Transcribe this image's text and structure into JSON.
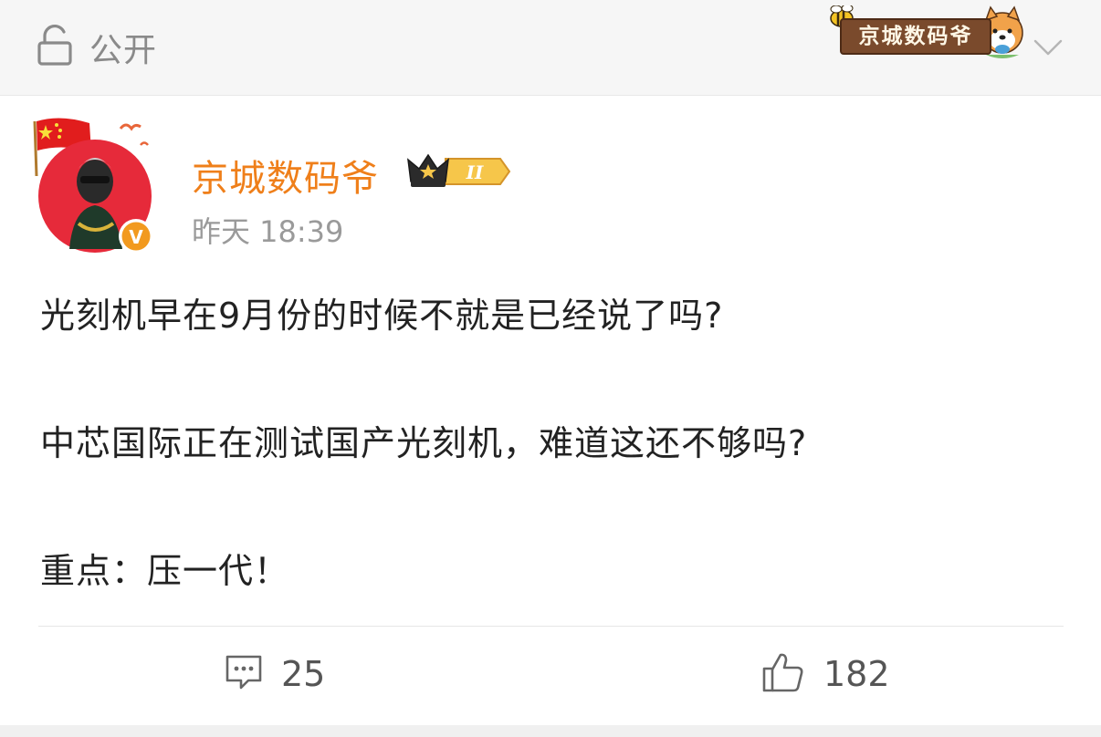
{
  "header": {
    "visibility_label": "公开",
    "watermark_text": "京城数码爷",
    "icons": [
      "lock-icon",
      "chevron-down-icon"
    ]
  },
  "post": {
    "author": {
      "name": "京城数码爷",
      "badge_text": "II",
      "verified_mark": "V",
      "name_color": "#ef7f1a"
    },
    "time": "昨天 18:39",
    "paragraphs": [
      "光刻机早在9月份的时候不就是已经说了吗?",
      "中芯国际正在测试国产光刻机，难道这还不够吗?",
      "重点：压一代！"
    ],
    "actions": {
      "comments": "25",
      "likes": "182"
    }
  },
  "colors": {
    "accent_orange": "#ef7f1a",
    "text_primary": "#222222",
    "text_secondary": "#9a9a9a",
    "header_bg": "#f6f6f6"
  }
}
